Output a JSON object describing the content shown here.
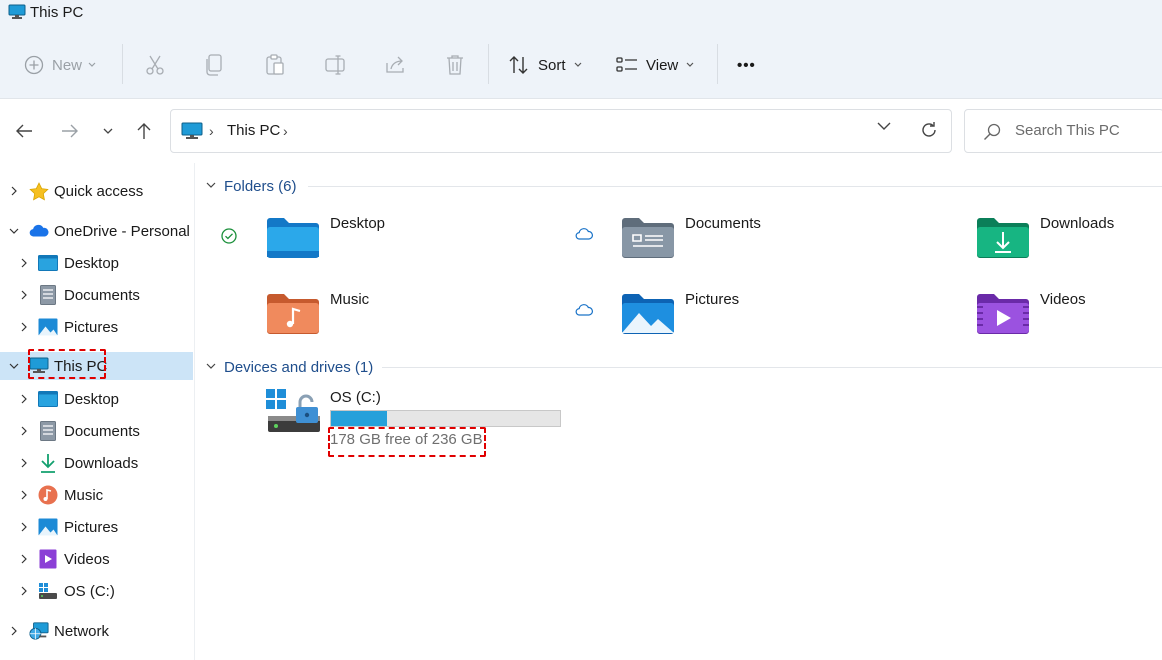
{
  "window": {
    "title": "This PC"
  },
  "toolbar": {
    "new_label": "New",
    "sort_label": "Sort",
    "view_label": "View",
    "more_label": "•••"
  },
  "address": {
    "crumbs": [
      "This PC"
    ]
  },
  "search": {
    "placeholder": "Search This PC"
  },
  "sidebar": {
    "items": [
      {
        "label": "Quick access"
      },
      {
        "label": "OneDrive - Personal"
      },
      {
        "label": "Desktop"
      },
      {
        "label": "Documents"
      },
      {
        "label": "Pictures"
      },
      {
        "label": "This PC"
      },
      {
        "label": "Desktop"
      },
      {
        "label": "Documents"
      },
      {
        "label": "Downloads"
      },
      {
        "label": "Music"
      },
      {
        "label": "Pictures"
      },
      {
        "label": "Videos"
      },
      {
        "label": "OS (C:)"
      },
      {
        "label": "Network"
      }
    ]
  },
  "folders_section": {
    "header": "Folders (6)",
    "items": [
      {
        "name": "Desktop",
        "status": "synced"
      },
      {
        "name": "Documents",
        "status": "cloud"
      },
      {
        "name": "Downloads",
        "status": "none"
      },
      {
        "name": "Music",
        "status": "none"
      },
      {
        "name": "Pictures",
        "status": "cloud"
      },
      {
        "name": "Videos",
        "status": "none"
      }
    ]
  },
  "drives_section": {
    "header": "Devices and drives (1)",
    "drives": [
      {
        "name": "OS (C:)",
        "free_text": "178 GB free of 236 GB",
        "used_fraction": 0.246
      }
    ]
  },
  "colors": {
    "selection": "#cce4f7",
    "accent": "#26a0da",
    "highlight_dash": "#e00000",
    "section_header": "#1f4e8c"
  }
}
